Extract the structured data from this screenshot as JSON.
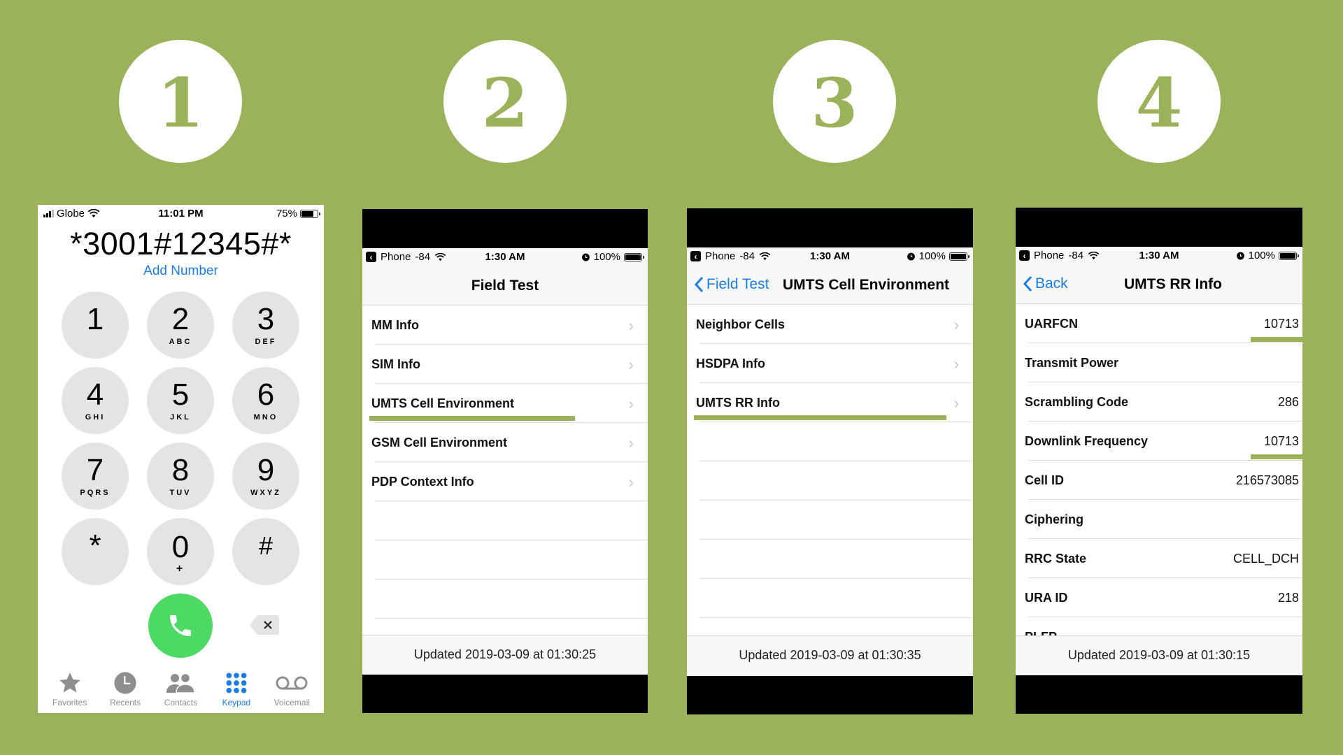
{
  "steps": [
    "1",
    "2",
    "3",
    "4"
  ],
  "colors": {
    "background": "#9bb25b",
    "highlight": "#9bb25b",
    "ios_blue": "#1a7ee6",
    "call_green": "#4cd964"
  },
  "screen1": {
    "status": {
      "carrier": "Globe",
      "time": "11:01 PM",
      "battery": "75%"
    },
    "dialed_number": "*3001#12345#*",
    "add_number": "Add Number",
    "keys": [
      {
        "digit": "1",
        "letters": ""
      },
      {
        "digit": "2",
        "letters": "ABC"
      },
      {
        "digit": "3",
        "letters": "DEF"
      },
      {
        "digit": "4",
        "letters": "GHI"
      },
      {
        "digit": "5",
        "letters": "JKL"
      },
      {
        "digit": "6",
        "letters": "MNO"
      },
      {
        "digit": "7",
        "letters": "PQRS"
      },
      {
        "digit": "8",
        "letters": "TUV"
      },
      {
        "digit": "9",
        "letters": "WXYZ"
      },
      {
        "digit": "*",
        "letters": ""
      },
      {
        "digit": "0",
        "letters": "+"
      },
      {
        "digit": "#",
        "letters": ""
      }
    ],
    "tabs": [
      {
        "label": "Favorites",
        "icon": "star-icon"
      },
      {
        "label": "Recents",
        "icon": "clock-icon"
      },
      {
        "label": "Contacts",
        "icon": "contacts-icon"
      },
      {
        "label": "Keypad",
        "icon": "keypad-icon",
        "active": true
      },
      {
        "label": "Voicemail",
        "icon": "voicemail-icon"
      }
    ]
  },
  "field_status": {
    "back_app": "Phone",
    "signal": "-84",
    "time": "1:30 AM",
    "battery": "100%"
  },
  "screen2": {
    "title": "Field Test",
    "rows": [
      "MM Info",
      "SIM Info",
      "UMTS Cell Environment",
      "GSM Cell Environment",
      "PDP Context Info"
    ],
    "highlighted": "UMTS Cell Environment",
    "footer": "Updated 2019-03-09 at 01:30:25"
  },
  "screen3": {
    "back_label": "Field Test",
    "title": "UMTS Cell Environment",
    "rows": [
      "Neighbor Cells",
      "HSDPA Info",
      "UMTS RR Info"
    ],
    "highlighted": "UMTS RR Info",
    "footer": "Updated 2019-03-09 at 01:30:35"
  },
  "screen4": {
    "back_label": "Back",
    "title": "UMTS RR Info",
    "rows": [
      {
        "label": "UARFCN",
        "value": "10713",
        "highlight": true
      },
      {
        "label": "Transmit Power",
        "value": ""
      },
      {
        "label": "Scrambling Code",
        "value": "286"
      },
      {
        "label": "Downlink Frequency",
        "value": "10713",
        "highlight": true
      },
      {
        "label": "Cell ID",
        "value": "216573085"
      },
      {
        "label": "Ciphering",
        "value": ""
      },
      {
        "label": "RRC State",
        "value": "CELL_DCH"
      },
      {
        "label": "URA ID",
        "value": "218"
      },
      {
        "label": "PLFP",
        "value": ""
      }
    ],
    "footer": "Updated 2019-03-09 at 01:30:15"
  }
}
